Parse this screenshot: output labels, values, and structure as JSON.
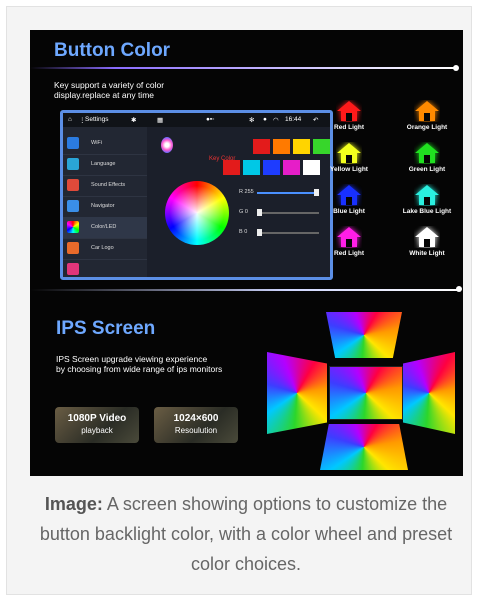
{
  "caption": {
    "label": "Image:",
    "text": " A screen showing options to customize the button backlight color, with a color wheel and preset color choices."
  },
  "button_color": {
    "title": "Button Color",
    "description_line1": "Key support a variety of color",
    "description_line2": "display.replace at any time",
    "tablet": {
      "status_settings": "Settings",
      "status_time": "16:44",
      "key_color_label": "Key Color",
      "menu": [
        {
          "label": "WiFi",
          "icon_color": "#2b7be0"
        },
        {
          "label": "Language",
          "icon_color": "#2aa5d6"
        },
        {
          "label": "Sound Effects",
          "icon_color": "#e04a3a"
        },
        {
          "label": "Navigator",
          "icon_color": "#3a8ee8"
        },
        {
          "label": "Color/LED",
          "icon_color": "#ffffff"
        },
        {
          "label": "Car Logo",
          "icon_color": "#e86a2a"
        }
      ],
      "sliders": [
        {
          "label": "R",
          "value": "255",
          "fraction": 1.0
        },
        {
          "label": "G",
          "value": "0",
          "fraction": 0.0
        },
        {
          "label": "B",
          "value": "0",
          "fraction": 0.0
        }
      ],
      "swatches": [
        "#e31b1b",
        "#ff7a00",
        "#ffd400",
        "#37d62b",
        "#e31b1b",
        "#00c8e6",
        "#1e3cff",
        "#e61ec8",
        "#ffffff"
      ]
    },
    "presets": [
      {
        "label": "Red Light",
        "color": "#ff1a1a"
      },
      {
        "label": "Orange Light",
        "color": "#ff8a00"
      },
      {
        "label": "Yellow Light",
        "color": "#f2ff1e"
      },
      {
        "label": "Green Light",
        "color": "#20e020"
      },
      {
        "label": "Blue Light",
        "color": "#1830ff"
      },
      {
        "label": "Lake Blue Light",
        "color": "#2af0e0"
      },
      {
        "label": "Red Light",
        "color": "#ff1ee6"
      },
      {
        "label": "White Light",
        "color": "#ffffff"
      }
    ]
  },
  "ips_screen": {
    "title": "IPS Screen",
    "description_line1": "IPS Screen upgrade viewing experience",
    "description_line2": "by choosing from wide range of ips monitors",
    "badge1_title": "1080P Video",
    "badge1_sub": "playback",
    "badge2_title": "1024×600",
    "badge2_sub": "Resoulution"
  }
}
